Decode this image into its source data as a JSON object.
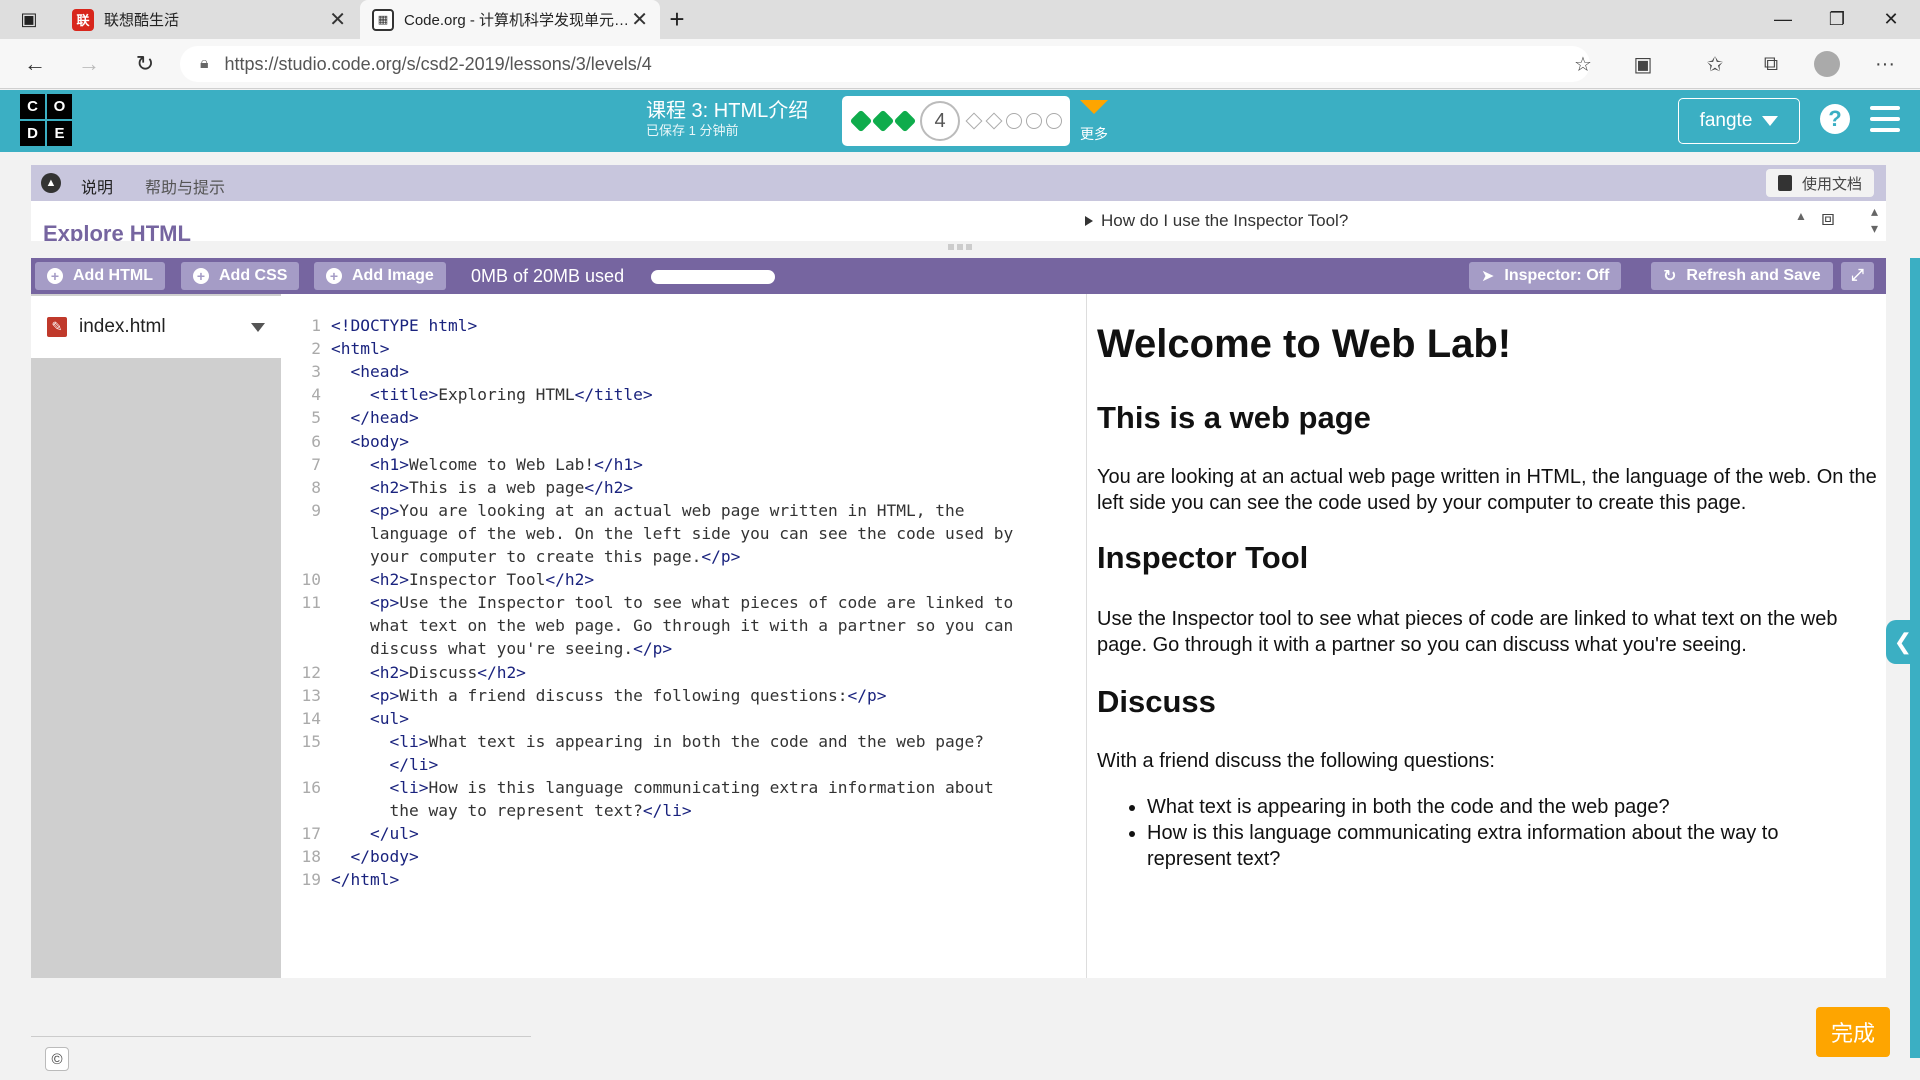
{
  "browser": {
    "tabs": [
      {
        "title": "联想酷生活",
        "favicon": "联"
      },
      {
        "title": "Code.org - 计算机科学发现单元…",
        "favicon": "▦"
      }
    ],
    "url": "https://studio.code.org/s/csd2-2019/lessons/3/levels/4",
    "icons": {
      "back": "←",
      "forward": "→",
      "reload": "↻",
      "lock": "🔒",
      "minimize": "—",
      "restore": "❐",
      "close": "✕",
      "new_tab": "+",
      "more": "···"
    }
  },
  "header": {
    "logo_letters": [
      "C",
      "O",
      "D",
      "E"
    ],
    "lesson_title": "课程 3: HTML介绍",
    "saved_text": "已保存 1 分钟前",
    "current_level": "4",
    "more_label": "更多",
    "user_name": "fangte",
    "help_symbol": "?"
  },
  "instructions": {
    "tabs": [
      "说明",
      "帮助与提示"
    ],
    "doc_button": "使用文档",
    "heading": "Explore HTML",
    "inspector_question": "How do I use the Inspector Tool?"
  },
  "toolbar": {
    "add_html": "Add HTML",
    "add_css": "Add CSS",
    "add_image": "Add Image",
    "usage_text": "0MB of 20MB used",
    "inspector": "Inspector: Off",
    "refresh_save": "Refresh and Save"
  },
  "files": [
    {
      "name": "index.html"
    }
  ],
  "code_lines": [
    {
      "n": "1",
      "text": "<!DOCTYPE html>"
    },
    {
      "n": "2",
      "text": "<html>"
    },
    {
      "n": "3",
      "text": "  <head>"
    },
    {
      "n": "4",
      "text": "    <title>Exploring HTML</title>"
    },
    {
      "n": "5",
      "text": "  </head>"
    },
    {
      "n": "6",
      "text": "  <body>"
    },
    {
      "n": "7",
      "text": "    <h1>Welcome to Web Lab!</h1>"
    },
    {
      "n": "8",
      "text": "    <h2>This is a web page</h2>"
    },
    {
      "n": "9",
      "text": "    <p>You are looking at an actual web page written in HTML, the"
    },
    {
      "n": "",
      "text": "    language of the web. On the left side you can see the code used by"
    },
    {
      "n": "",
      "text": "    your computer to create this page.</p>"
    },
    {
      "n": "10",
      "text": "    <h2>Inspector Tool</h2>"
    },
    {
      "n": "11",
      "text": "    <p>Use the Inspector tool to see what pieces of code are linked to"
    },
    {
      "n": "",
      "text": "    what text on the web page. Go through it with a partner so you can"
    },
    {
      "n": "",
      "text": "    discuss what you're seeing.</p>"
    },
    {
      "n": "12",
      "text": "    <h2>Discuss</h2>"
    },
    {
      "n": "13",
      "text": "    <p>With a friend discuss the following questions:</p>"
    },
    {
      "n": "14",
      "text": "    <ul>"
    },
    {
      "n": "15",
      "text": "      <li>What text is appearing in both the code and the web page?"
    },
    {
      "n": "",
      "text": "      </li>"
    },
    {
      "n": "16",
      "text": "      <li>How is this language communicating extra information about"
    },
    {
      "n": "",
      "text": "      the way to represent text?</li>"
    },
    {
      "n": "17",
      "text": "    </ul>"
    },
    {
      "n": "18",
      "text": "  </body>"
    },
    {
      "n": "19",
      "text": "</html>"
    }
  ],
  "preview": {
    "h1": "Welcome to Web Lab!",
    "h2_1": "This is a web page",
    "p1": "You are looking at an actual web page written in HTML, the language of the web. On the left side you can see the code used by your computer to create this page.",
    "h2_2": "Inspector Tool",
    "p2": "Use the Inspector tool to see what pieces of code are linked to what text on the web page. Go through it with a partner so you can discuss what you're seeing.",
    "h2_3": "Discuss",
    "p3": "With a friend discuss the following questions:",
    "li1": "What text is appearing in both the code and the web page?",
    "li2": "How is this language communicating extra information about the way to represent text?"
  },
  "footer": {
    "copyright_symbol": "©",
    "finish_button": "完成"
  }
}
